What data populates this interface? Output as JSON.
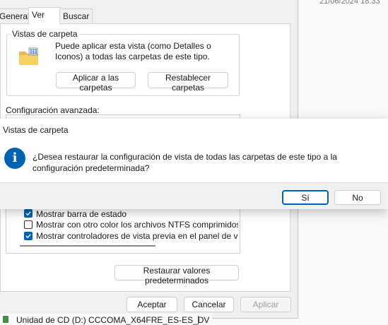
{
  "background": {
    "date": "21/06/2024 18:33",
    "drive_label": "Unidad de CD (D:) CCCOMA_X64FRE_ES-ES_DV"
  },
  "folder_options": {
    "tabs": [
      {
        "label": "General",
        "active": false
      },
      {
        "label": "Ver",
        "active": true
      },
      {
        "label": "Buscar",
        "active": false
      }
    ],
    "folder_views": {
      "title": "Vistas de carpeta",
      "description": "Puede aplicar esta vista (como Detalles o Iconos) a todas las carpetas de este tipo.",
      "apply_button": "Aplicar a las carpetas",
      "reset_button": "Restablecer carpetas"
    },
    "advanced_label": "Configuración avanzada:",
    "advanced_items": [
      {
        "label": "Mostrar barra de estado",
        "checked": true
      },
      {
        "label": "Mostrar con otro color los archivos NTFS comprimidos o c",
        "checked": false
      },
      {
        "label": "Mostrar controladores de vista previa en el panel de vista",
        "checked": true
      }
    ],
    "restore_defaults_button": "Restaurar valores predeterminados",
    "ok_button": "Aceptar",
    "cancel_button": "Cancelar",
    "apply_button": "Aplicar"
  },
  "dialog": {
    "title": "Vistas de carpeta",
    "message": "¿Desea restaurar la configuración de vista de todas las carpetas de este tipo a la configuración predeterminada?",
    "yes_button": "Sí",
    "no_button": "No"
  },
  "colors": {
    "accent": "#0063b1"
  }
}
